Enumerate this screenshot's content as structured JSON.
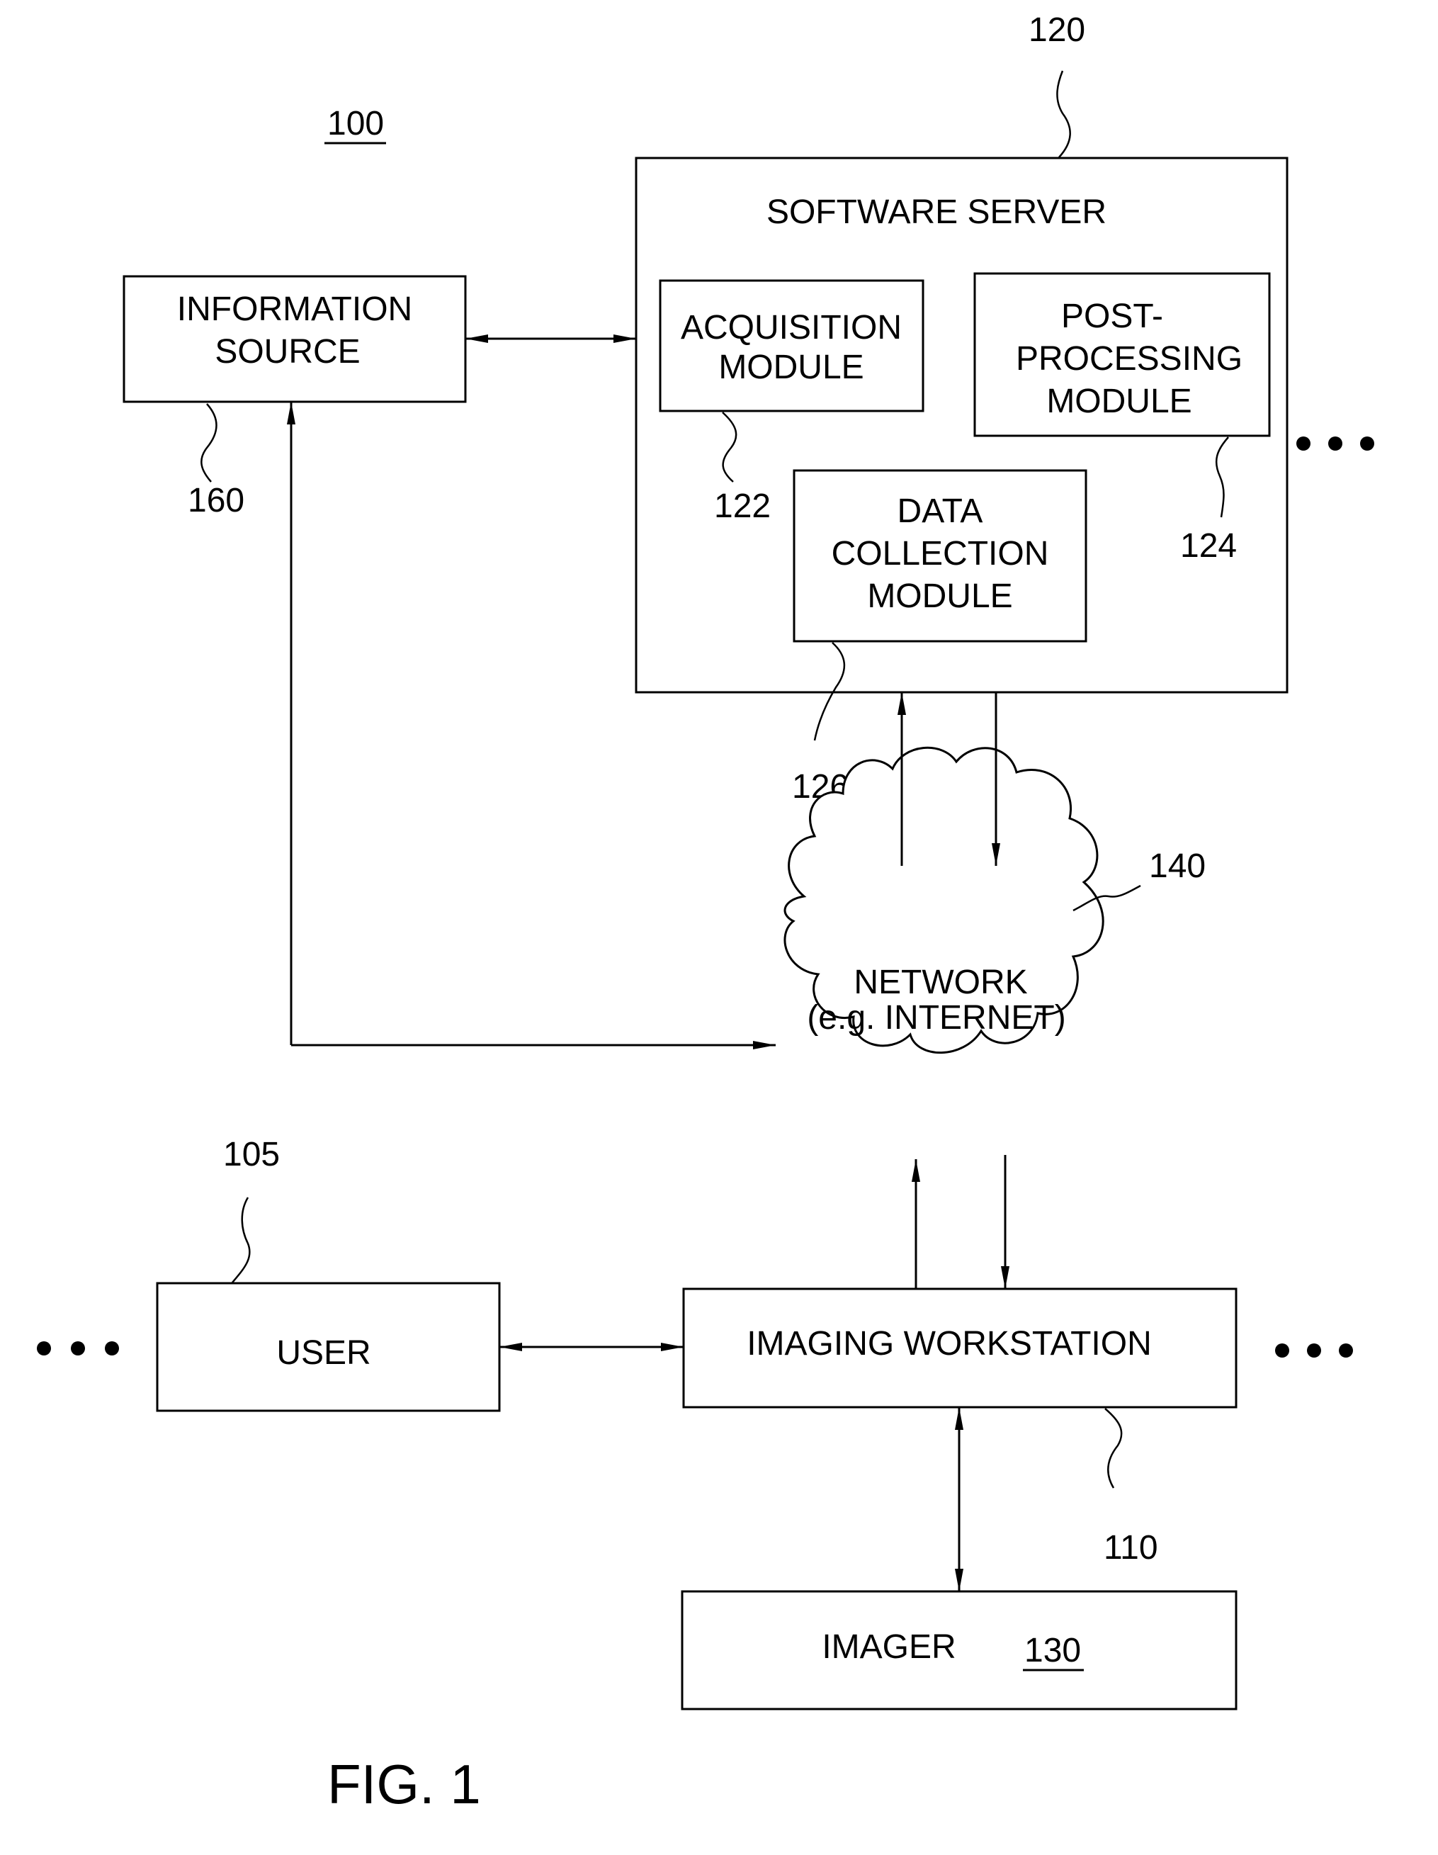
{
  "figure": {
    "caption": "FIG. 1",
    "system_ref": "100"
  },
  "nodes": {
    "information_source": {
      "lines": [
        "INFORMATION",
        "SOURCE"
      ],
      "ref": "160"
    },
    "software_server": {
      "title": "SOFTWARE SERVER",
      "ref": "120"
    },
    "acquisition_module": {
      "lines": [
        "ACQUISITION",
        "MODULE"
      ],
      "ref": "122"
    },
    "post_processing_module": {
      "lines": [
        "POST-",
        "PROCESSING",
        "MODULE"
      ],
      "ref": "124"
    },
    "data_collection_module": {
      "lines": [
        "DATA",
        "COLLECTION",
        "MODULE"
      ],
      "ref": "126"
    },
    "network": {
      "lines": [
        "NETWORK",
        "(e.g. INTERNET)"
      ],
      "ref": "140"
    },
    "user": {
      "label": "USER",
      "ref": "105"
    },
    "imaging_workstation": {
      "label": "IMAGING WORKSTATION",
      "ref": "110"
    },
    "imager": {
      "label": "IMAGER",
      "ref": "130"
    }
  },
  "edges": [
    {
      "from": "information_source",
      "to": "software_server",
      "direction": "bidirectional"
    },
    {
      "from": "information_source",
      "to": "network",
      "direction": "bidirectional"
    },
    {
      "from": "network",
      "to": "software_server",
      "direction": "one-way"
    },
    {
      "from": "software_server",
      "to": "network",
      "direction": "one-way"
    },
    {
      "from": "imaging_workstation",
      "to": "network",
      "direction": "one-way"
    },
    {
      "from": "network",
      "to": "imaging_workstation",
      "direction": "one-way"
    },
    {
      "from": "user",
      "to": "imaging_workstation",
      "direction": "bidirectional"
    },
    {
      "from": "imaging_workstation",
      "to": "imager",
      "direction": "bidirectional"
    }
  ],
  "ellipses": [
    "more-servers",
    "more-users",
    "more-workstations"
  ]
}
